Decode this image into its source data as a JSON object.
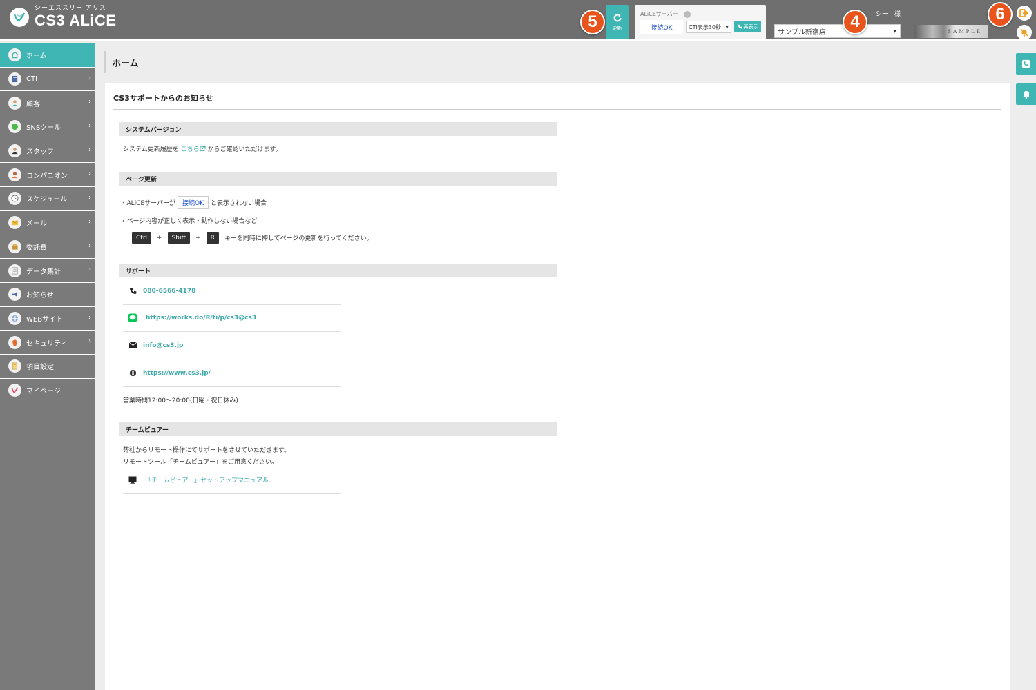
{
  "header": {
    "logo_sub": "シーエススリー アリス",
    "logo_main": "CS3 ALiCE",
    "badge_refresh": "5",
    "badge_store": "4",
    "badge_logout": "6",
    "refresh_label": "更新",
    "server_title": "ALiCEサーバー",
    "server_info": "i",
    "server_status": "接続OK",
    "cti_interval": "CTI表示30秒",
    "redisplay_label": "再表示",
    "user_name": "シー　様",
    "store_selected": "サンプル新宿店",
    "sample_text": "SAMPLE"
  },
  "sidebar": {
    "items": [
      {
        "label": "ホーム",
        "icon": "home-icon"
      },
      {
        "label": "CTI",
        "icon": "cti-icon"
      },
      {
        "label": "顧客",
        "icon": "customer-icon"
      },
      {
        "label": "SNSツール",
        "icon": "sns-icon"
      },
      {
        "label": "スタッフ",
        "icon": "staff-icon"
      },
      {
        "label": "コンパニオン",
        "icon": "companion-icon"
      },
      {
        "label": "スケジュール",
        "icon": "clock-icon"
      },
      {
        "label": "メール",
        "icon": "mail-icon"
      },
      {
        "label": "委託費",
        "icon": "fee-icon"
      },
      {
        "label": "データ集計",
        "icon": "data-icon"
      },
      {
        "label": "お知らせ",
        "icon": "megaphone-icon"
      },
      {
        "label": "WEBサイト",
        "icon": "globe-icon"
      },
      {
        "label": "セキュリティ",
        "icon": "security-icon"
      },
      {
        "label": "項目設定",
        "icon": "settings-icon"
      },
      {
        "label": "マイページ",
        "icon": "mypage-icon"
      }
    ]
  },
  "main": {
    "page_title": "ホーム",
    "card_title": "CS3サポートからのお知らせ",
    "version": {
      "heading": "システムバージョン",
      "text_before": "システム更新履歴を",
      "link": "こちら",
      "text_after": "からご確認いただけます。"
    },
    "page_update": {
      "heading": "ページ更新",
      "line1_before": "ALiCEサーバーが",
      "line1_badge": "接続OK",
      "line1_after": "と表示されない場合",
      "line2": "ページ内容が正しく表示・動作しない場合など",
      "key1": "Ctrl",
      "key2": "Shift",
      "key3": "R",
      "plus": "+",
      "keys_text": "キーを同時に押してページの更新を行ってください。"
    },
    "support": {
      "heading": "サポート",
      "phone": "080-6566-4178",
      "line": "https://works.do/R/ti/p/cs3@cs3",
      "email": "info@cs3.jp",
      "web": "https://www.cs3.jp/",
      "hours": "営業時間12:00～20:00(日曜・祝日休み)"
    },
    "teamviewer": {
      "heading": "チームビュアー",
      "line1": "弊社からリモート操作にてサポートをさせていただきます。",
      "line2": "リモートツール「チームビュアー」をご用意ください。",
      "manual": "「チームビュアー」セットアップマニュアル"
    }
  },
  "colors": {
    "accent": "#3fb6b4",
    "header": "#6f6f6f",
    "sidebar": "#7a7a7a",
    "badge": "#e8541c"
  }
}
